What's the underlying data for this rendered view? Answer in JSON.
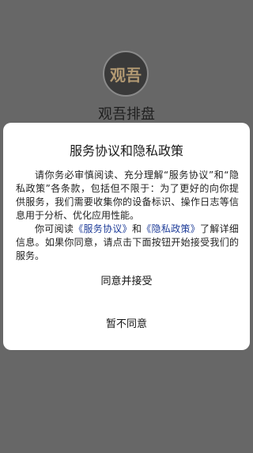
{
  "app": {
    "logo_text": "观吾",
    "name": "观吾排盘"
  },
  "dialog": {
    "title": "服务协议和隐私政策",
    "paragraph1": "请你务必审慎阅读、充分理解“服务协议”和“隐私政策”各条款，包括但不限于：为了更好的向你提供服务，我们需要收集你的设备标识、操作日志等信息用于分析、优化应用性能。",
    "paragraph2_prefix": "你可阅读",
    "service_link": "《服务协议》",
    "and_text": "和",
    "privacy_link": "《隐私政策》",
    "paragraph2_suffix": "了解详细信息。如果你同意，请点击下面按钮开始接受我们的服务。",
    "agree_label": "同意并接受",
    "decline_label": "暂不同意"
  },
  "colors": {
    "overlay": "#676767",
    "dialog_bg": "#ffffff",
    "link": "#1f3d99",
    "logo_text": "#b39a73"
  }
}
